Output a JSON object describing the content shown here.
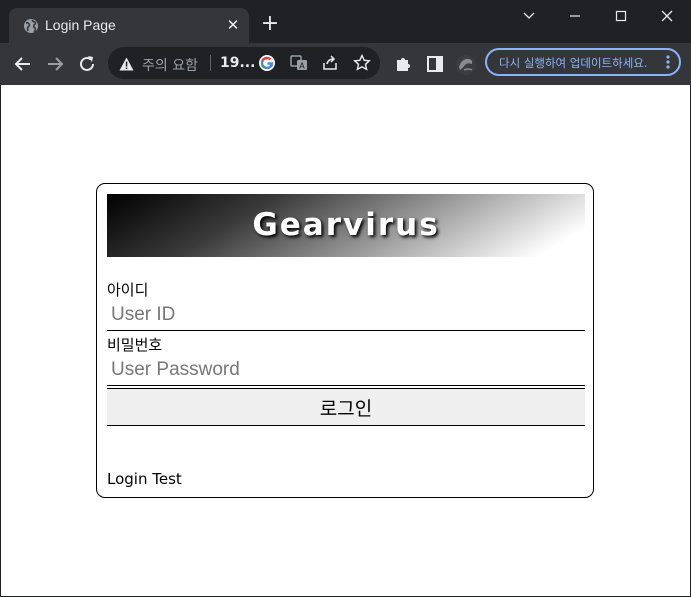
{
  "browser": {
    "tab_title": "Login Page",
    "new_tab_symbol": "+",
    "address_warning": "주의 요함",
    "address_url": "19...",
    "update_button_label": "다시 실행하여 업데이트하세요."
  },
  "page": {
    "brand_title": "Gearvirus",
    "id_label": "아이디",
    "id_placeholder": "User ID",
    "password_label": "비밀번호",
    "password_placeholder": "User Password",
    "login_button_label": "로그인",
    "footer_text": "Login Test"
  },
  "colors": {
    "browser_frame": "#202124",
    "toolbar": "#35363a",
    "update_accent": "#8ab4f8",
    "page_background": "#ffffff",
    "login_button_bg": "#efefef"
  },
  "icons": [
    "globe-icon",
    "close-icon",
    "back-arrow-icon",
    "forward-arrow-icon",
    "reload-icon",
    "warning-icon",
    "google-icon",
    "translate-icon",
    "share-icon",
    "star-icon",
    "extensions-icon",
    "side-panel-icon",
    "profile-avatar-icon",
    "more-vert-icon"
  ]
}
